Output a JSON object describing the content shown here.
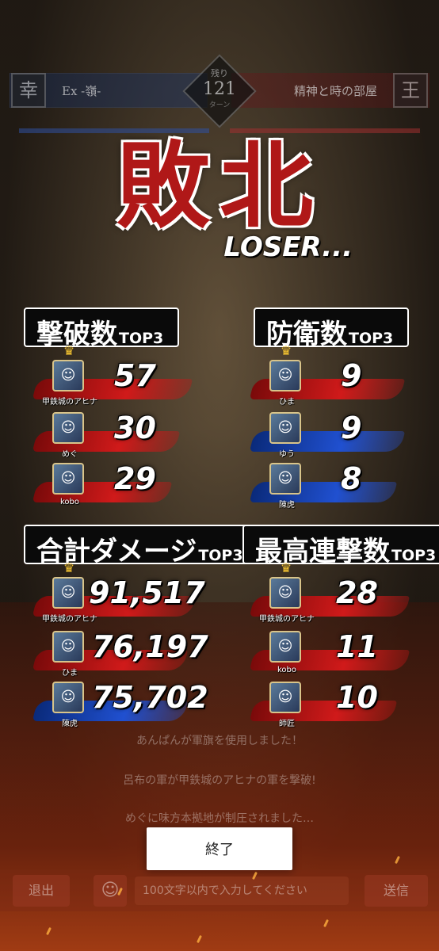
{
  "top_bar": {
    "left_team": "Ex -嶺-",
    "right_team": "精神と時の部屋",
    "left_emblem": "幸",
    "right_emblem": "王",
    "turn_label": "残り",
    "turn_value": "121",
    "turn_unit": "ターン"
  },
  "result": {
    "title": "敗北",
    "subtitle": "LOSER..."
  },
  "kills": {
    "label": "撃破数",
    "top3": "TOP3",
    "entries": [
      {
        "name": "甲鉄城のアヒナ",
        "value": "57",
        "color": "red",
        "crown": true
      },
      {
        "name": "めぐ",
        "value": "30",
        "color": "red",
        "crown": false
      },
      {
        "name": "kobo",
        "value": "29",
        "color": "red",
        "crown": false
      }
    ]
  },
  "defense": {
    "label": "防衛数",
    "top3": "TOP3",
    "entries": [
      {
        "name": "ひま",
        "value": "9",
        "color": "red",
        "crown": true
      },
      {
        "name": "ゆう",
        "value": "9",
        "color": "blue",
        "crown": false
      },
      {
        "name": "陳虎",
        "value": "8",
        "color": "blue",
        "crown": false
      }
    ]
  },
  "damage": {
    "label": "合計ダメージ",
    "top3": "TOP3",
    "entries": [
      {
        "name": "甲鉄城のアヒナ",
        "value": "91,517",
        "color": "red",
        "crown": true
      },
      {
        "name": "ひま",
        "value": "76,197",
        "color": "red",
        "crown": false
      },
      {
        "name": "陳虎",
        "value": "75,702",
        "color": "blue",
        "crown": false
      }
    ]
  },
  "combo": {
    "label": "最高連撃数",
    "top3": "TOP3",
    "entries": [
      {
        "name": "甲鉄城のアヒナ",
        "value": "28",
        "color": "red",
        "crown": true
      },
      {
        "name": "kobo",
        "value": "11",
        "color": "red",
        "crown": false
      },
      {
        "name": "師匠",
        "value": "10",
        "color": "red",
        "crown": false
      }
    ]
  },
  "background_chat": {
    "line1": "あんぱんが軍旗を使用しました！",
    "line2": "呂布の軍が甲鉄城のアヒナの軍を撃破!",
    "line3": "めぐに味方本拠地が制圧されました…"
  },
  "end_button": "終了",
  "bottom_bar": {
    "retreat": "退出",
    "smile_icon": "☺",
    "input_placeholder": "100文字以内で入力してください",
    "send": "送信"
  },
  "colors": {
    "red_stroke": "#d01a1a",
    "blue_stroke": "#2050d0",
    "title_red": "#b01818"
  }
}
